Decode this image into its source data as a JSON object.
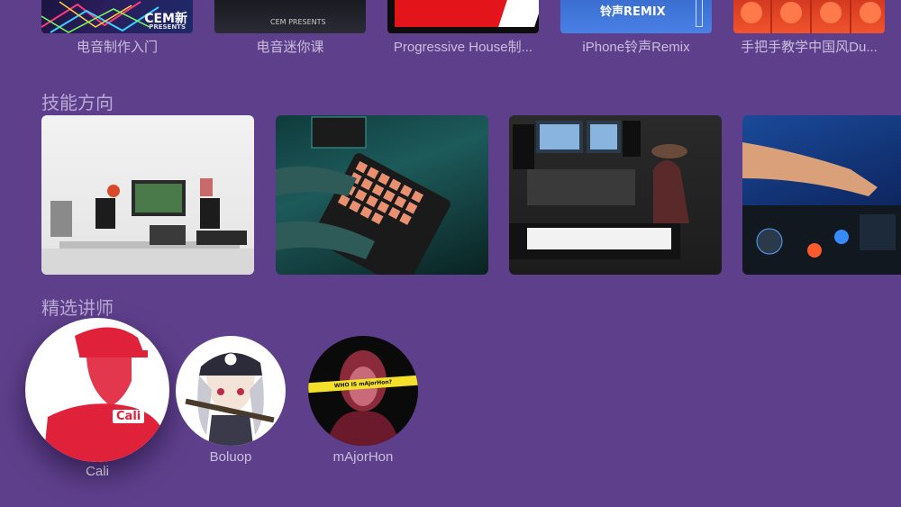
{
  "courses": [
    {
      "label": "电音制作入门",
      "thumb_text": "CEM新",
      "thumb_sub": "PRESENTS"
    },
    {
      "label": "电音迷你课",
      "thumb_text": "CEM PRESENTS"
    },
    {
      "label": "Progressive House制...",
      "thumb_text": ""
    },
    {
      "label": "iPhone铃声Remix",
      "thumb_text": "铃声REMIX"
    },
    {
      "label": "手把手教学中国风Du...",
      "thumb_text": ""
    }
  ],
  "sections": {
    "skills_title": "技能方向",
    "instructors_title": "精选讲师"
  },
  "instructors": [
    {
      "name": "Cali",
      "focused": true,
      "shirt_text": "Cali"
    },
    {
      "name": "Boluop",
      "focused": false
    },
    {
      "name": "mAjorHon",
      "focused": false,
      "banner_text": "WHO IS mAjorHon?"
    }
  ],
  "colors": {
    "background": "#5e3f8c",
    "label": "#c9bfdc",
    "section_title": "#b9aad3",
    "focused_label": "#ffffff"
  }
}
